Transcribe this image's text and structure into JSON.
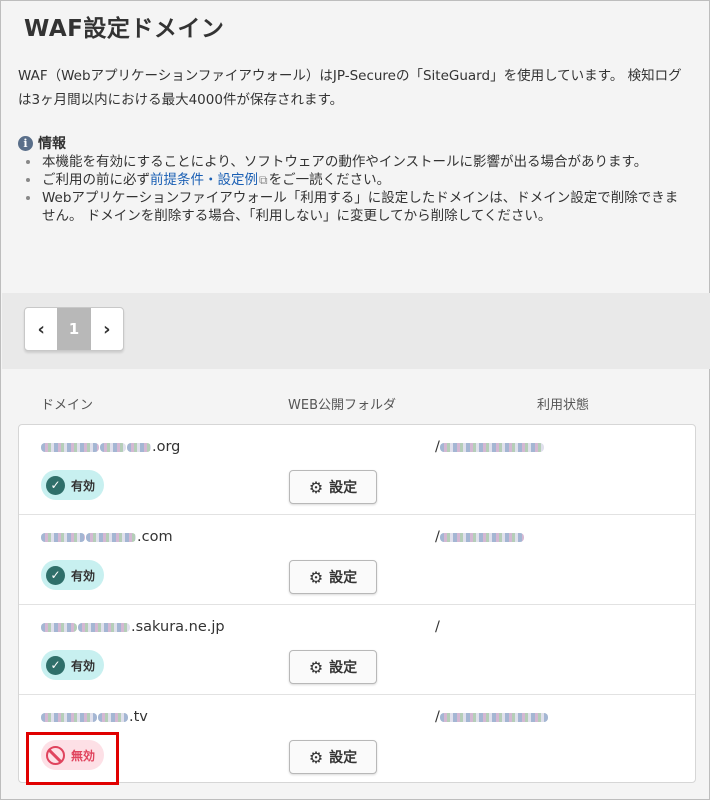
{
  "page": {
    "title": "WAF設定ドメイン",
    "description": "WAF（Webアプリケーションファイアウォール）はJP-Secureの「SiteGuard」を使用しています。 検知ログは3ヶ月間以内における最大4000件が保存されます。"
  },
  "info": {
    "heading": "情報",
    "items": [
      "本機能を有効にすることにより、ソフトウェアの動作やインストールに影響が出る場合があります。",
      "ご利用の前に必ず",
      "Webアプリケーションファイアウォール「利用する」に設定したドメインは、ドメイン設定で削除できません。 ドメインを削除する場合、「利用しない」に変更してから削除してください。"
    ],
    "link_text": "前提条件・設定例",
    "link_suffix": "をご一読ください。"
  },
  "pagination": {
    "prev": "‹",
    "current": "1",
    "next": "›"
  },
  "table": {
    "headers": {
      "domain": "ドメイン",
      "folder": "WEB公開フォルダ",
      "status": "利用状態"
    },
    "rows": [
      {
        "domain_suffix": ".org",
        "folder": "/",
        "status": "有効",
        "enabled": true,
        "button": "設定"
      },
      {
        "domain_suffix": ".com",
        "folder": "/",
        "status": "有効",
        "enabled": true,
        "button": "設定"
      },
      {
        "domain_suffix": ".sakura.ne.jp",
        "folder": "/",
        "status": "有効",
        "enabled": true,
        "button": "設定"
      },
      {
        "domain_suffix": ".tv",
        "folder": "/",
        "status": "無効",
        "enabled": false,
        "button": "設定"
      }
    ]
  },
  "colors": {
    "enabled_badge": "#c8f0f0",
    "disabled_badge": "#fde0e6",
    "disabled_text": "#e0445e",
    "highlight": "#e00000",
    "link": "#1a5fb4"
  },
  "icons": {
    "info": "info-icon",
    "enabled": "check-circle-icon",
    "disabled": "ban-icon",
    "settings": "gear-icon",
    "external": "external-link-icon"
  }
}
